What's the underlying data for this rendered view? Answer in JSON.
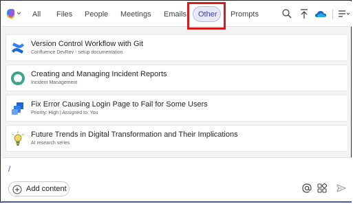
{
  "tabs": [
    {
      "label": "All"
    },
    {
      "label": "Files"
    },
    {
      "label": "People"
    },
    {
      "label": "Meetings"
    },
    {
      "label": "Emails"
    },
    {
      "label": "Other",
      "active": true
    },
    {
      "label": "Prompts"
    }
  ],
  "results": [
    {
      "title": "Version Control Workflow with Git",
      "subtitle": "Confluence DevRev - setup documentation",
      "icon": "confluence-icon"
    },
    {
      "title": "Creating and Managing Incident Reports",
      "subtitle": "Incident Management",
      "icon": "incident-icon"
    },
    {
      "title": "Fix Error Causing Login Page to Fail for Some Users",
      "subtitle": "Priority: High | Assigned to: You",
      "icon": "jira-icon"
    },
    {
      "title": "Future Trends in Digital Transformation and Their Implications",
      "subtitle": "AI research series",
      "icon": "lightbulb-icon"
    }
  ],
  "composer": {
    "input_value": "/",
    "add_content_label": "Add content"
  },
  "colors": {
    "accent": "#4b53bc",
    "highlight": "#d31b1b",
    "active_tab_bg": "#e7e9f7"
  }
}
